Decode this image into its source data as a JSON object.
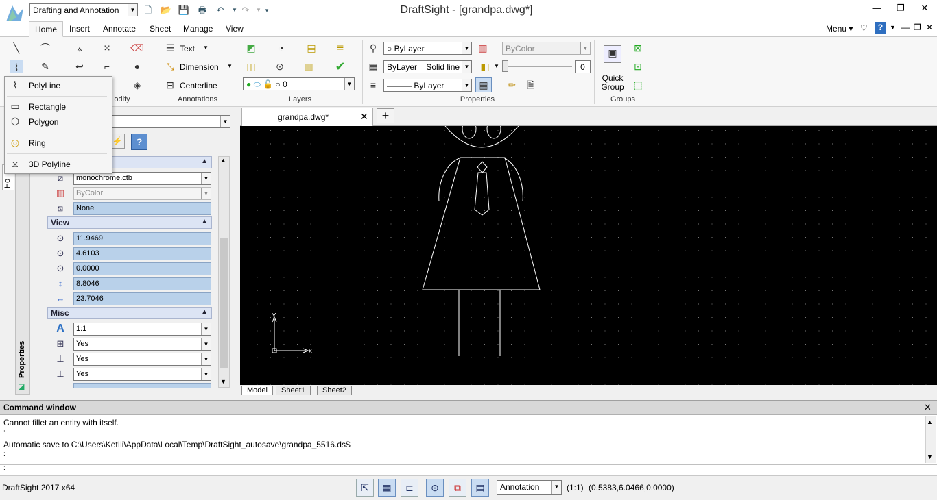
{
  "app": {
    "window_title": "DraftSight - [grandpa.dwg*]",
    "workspace": "Drafting and Annotation",
    "menu_label": "Menu"
  },
  "tabs": [
    "Home",
    "Insert",
    "Annotate",
    "Sheet",
    "Manage",
    "View"
  ],
  "ribbon": {
    "annotations": {
      "text": "Text",
      "dimension": "Dimension",
      "centerline": "Centerline",
      "label": "Annotations"
    },
    "modify_label": "odify",
    "layers": {
      "layer_name": "0",
      "label": "Layers"
    },
    "properties": {
      "color": "ByLayer",
      "linestyle_left": "ByLayer",
      "linestyle_right": "Solid line",
      "lineweight": "ByLayer",
      "transparency_color": "ByColor",
      "transparency_value": "0",
      "label": "Properties"
    },
    "groups": {
      "quick_group_line1": "Quick",
      "quick_group_line2": "Group",
      "label": "Groups"
    }
  },
  "flyout": {
    "items": [
      {
        "label": "PolyLine",
        "icon": "polyline-icon"
      },
      {
        "label": "Rectangle",
        "icon": "rectangle-icon"
      },
      {
        "label": "Polygon",
        "icon": "polygon-icon"
      },
      {
        "label": "Ring",
        "icon": "ring-icon"
      },
      {
        "label": "3D Polyline",
        "icon": "3d-polyline-icon"
      }
    ]
  },
  "properties_panel": {
    "tab_label": "Properties",
    "left_tab_label": "Ho",
    "print": {
      "style_table": "monochrome.ctb",
      "color": "ByColor",
      "none": "None"
    },
    "view": {
      "title": "View",
      "center_x": "11.9469",
      "center_y": "4.6103",
      "center_z": "0.0000",
      "height": "8.8046",
      "width": "23.7046"
    },
    "misc": {
      "title": "Misc",
      "scale": "1:1",
      "ucs_icon_on": "Yes",
      "ucs_icon_origin": "Yes",
      "ucs_per_viewport": "Yes"
    }
  },
  "document": {
    "tab_label": "grandpa.dwg*",
    "sheets": [
      "Model",
      "Sheet1",
      "Sheet2"
    ],
    "axis_x": "X",
    "axis_y": "Y"
  },
  "command_window": {
    "title": "Command window",
    "lines": [
      "Cannot fillet an entity with itself.",
      ":",
      "Automatic save to C:\\Users\\KetIli\\AppData\\Local\\Temp\\DraftSight_autosave\\grandpa_5516.ds$",
      ":"
    ],
    "prompt": ":"
  },
  "status": {
    "app_version": "DraftSight 2017 x64",
    "annotation_scale_mode": "Annotation",
    "scale": "(1:1)",
    "coordinates": "(0.5383,6.0466,0.0000)"
  },
  "colors": {
    "accent": "#1e6fc4",
    "canvas": "#000000",
    "selection": "#b9d1ea"
  }
}
